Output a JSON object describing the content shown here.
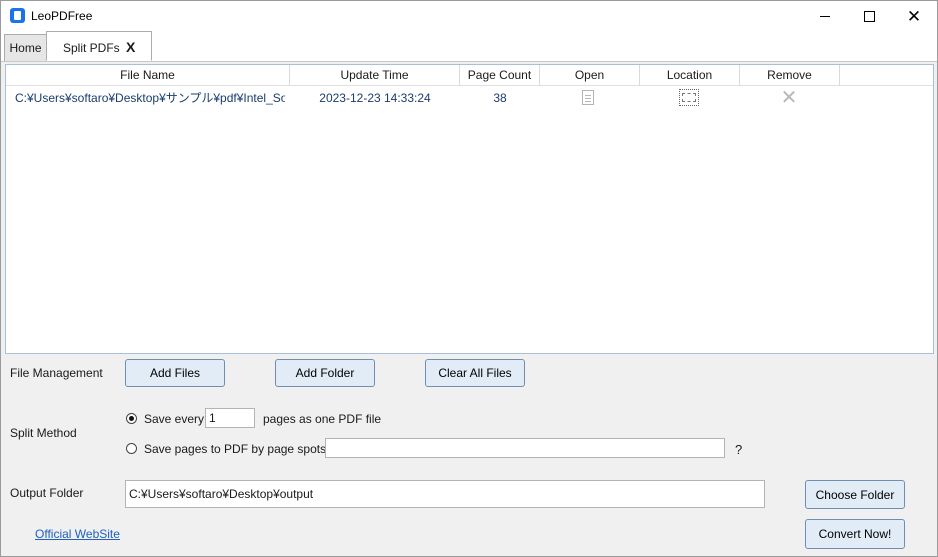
{
  "app": {
    "title": "LeoPDFree"
  },
  "tabs": {
    "home": "Home",
    "split": "Split PDFs",
    "close_glyph": "X"
  },
  "grid": {
    "columns": [
      "File Name",
      "Update Time",
      "Page Count",
      "Open",
      "Location",
      "Remove"
    ],
    "rows": [
      {
        "file_name": "C:¥Users¥softaro¥Desktop¥サンプル¥pdf¥Intel_Solid",
        "update_time": "2023-12-23 14:33:24",
        "page_count": "38"
      }
    ]
  },
  "file_management": {
    "label": "File Management",
    "add_files": "Add Files",
    "add_folder": "Add Folder",
    "clear_all": "Clear All Files"
  },
  "split_method": {
    "label": "Split Method",
    "option_every_prefix": "Save every",
    "option_every_value": "1",
    "option_every_suffix": "pages as one PDF file",
    "option_spots": "Save pages to PDF by page spots",
    "option_spots_value": "",
    "help": "?",
    "selected": "every"
  },
  "output": {
    "label": "Output Folder",
    "path": "C:¥Users¥softaro¥Desktop¥output",
    "choose": "Choose Folder"
  },
  "footer": {
    "website": "Official WebSite",
    "convert": "Convert Now!"
  },
  "icons": [
    "app-icon",
    "minimize-icon",
    "maximize-icon",
    "close-icon",
    "document-icon",
    "folder-icon",
    "remove-icon"
  ]
}
